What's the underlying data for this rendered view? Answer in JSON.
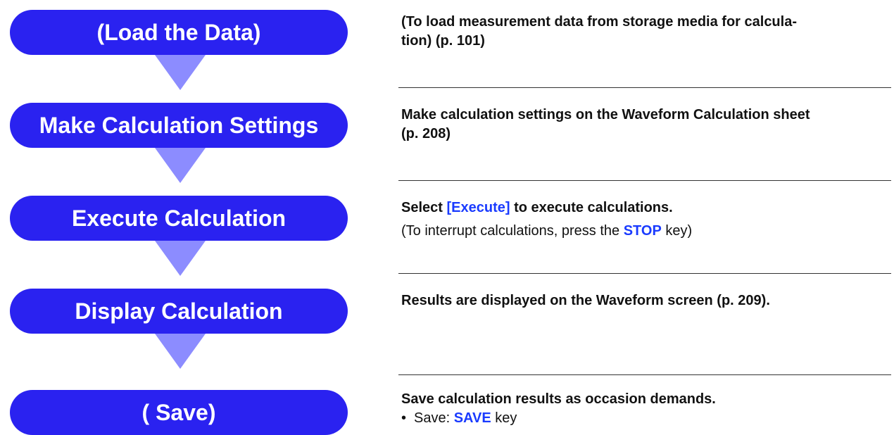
{
  "steps": [
    {
      "label": "(Load the Data)"
    },
    {
      "label": "Make Calculation Settings"
    },
    {
      "label": "Execute Calculation"
    },
    {
      "label": "Display Calculation"
    },
    {
      "label": "( Save)"
    }
  ],
  "descriptions": {
    "load": {
      "line1": "(To load measurement data from storage media for calcula-",
      "line2": "tion) (p. 101)"
    },
    "settings": {
      "line1": "Make calculation settings on the Waveform Calculation sheet",
      "line2": "(p. 208)"
    },
    "execute": {
      "pre": "Select ",
      "key": "[Execute]",
      "post": " to execute calculations.",
      "note_pre": "(To interrupt calculations, press the ",
      "note_key": "STOP",
      "note_post": " key)"
    },
    "display": {
      "text": "Results are displayed on the Waveform screen (p. 209)."
    },
    "save": {
      "text": "Save calculation results as occasion demands.",
      "bullet": "•",
      "item_pre": "Save: ",
      "item_key": "SAVE",
      "item_post": " key"
    }
  },
  "colors": {
    "pill": "#2a22f0",
    "arrow": "#8c8cff",
    "highlight": "#1a3bff"
  }
}
